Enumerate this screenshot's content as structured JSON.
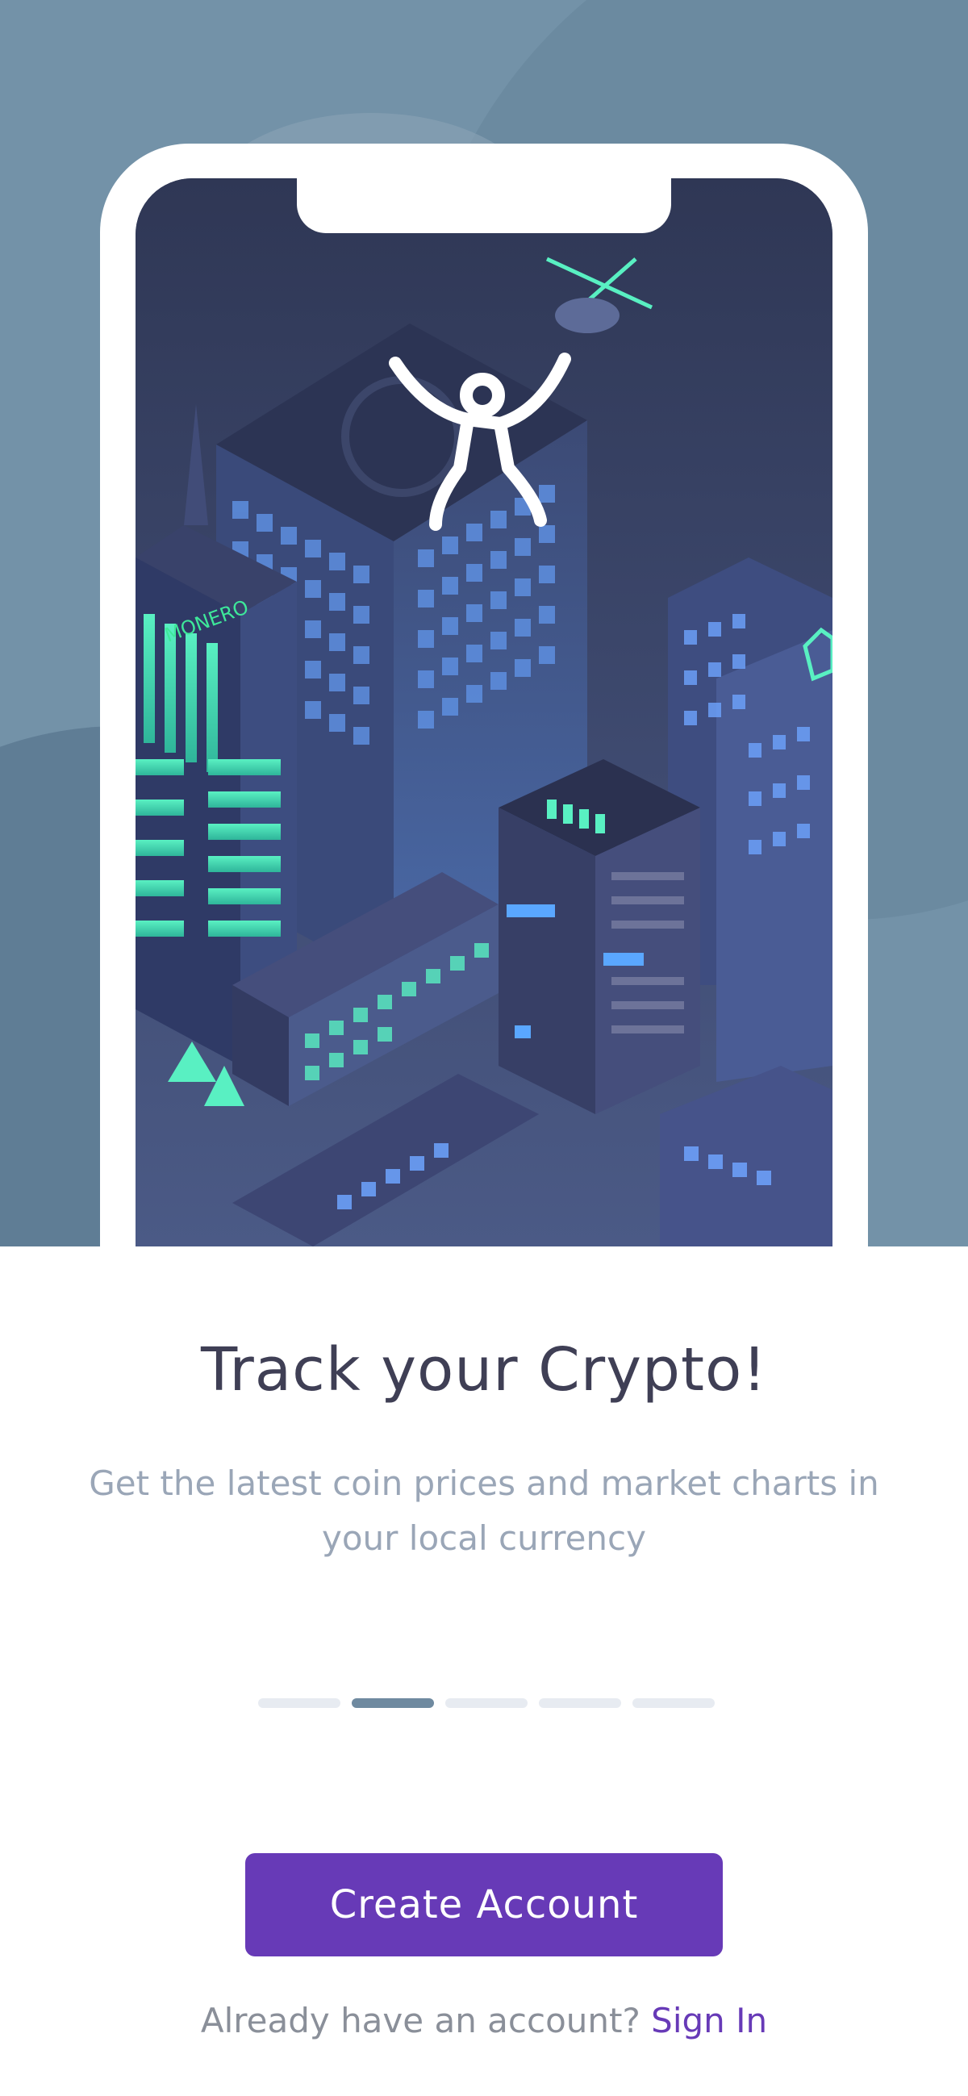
{
  "hero": {
    "illustration": "isometric-crypto-city",
    "building_signs": [
      "MONERO"
    ],
    "mascot_icon": "jumping-person-icon"
  },
  "onboarding": {
    "title": "Track your Crypto!",
    "subtitle": "Get the latest coin prices and market charts in your local currency",
    "page_indicator": {
      "total": 5,
      "active_index": 1
    }
  },
  "actions": {
    "create_account_label": "Create Account",
    "signin_prompt": "Already have an account?",
    "signin_link": "Sign In"
  },
  "colors": {
    "accent": "#673ab7",
    "hero_background": "#7392a8",
    "title_text": "#3f3f55",
    "subtitle_text": "#9aa6b7"
  }
}
